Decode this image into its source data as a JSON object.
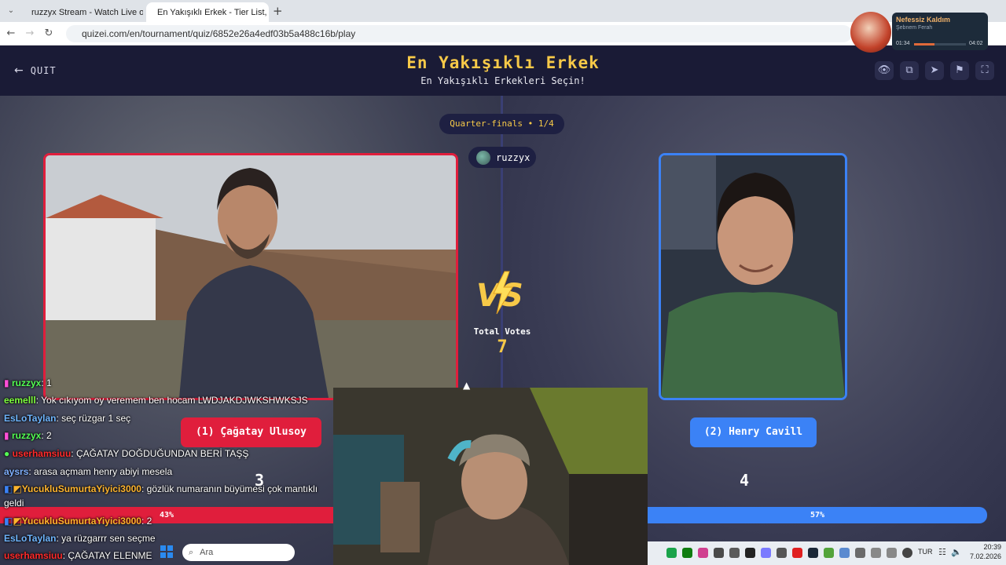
{
  "browser": {
    "tabs": [
      {
        "label": "ruzzyx Stream - Watch Live on K"
      },
      {
        "label": "En Yakışıklı Erkek - Tier List, Blin"
      }
    ],
    "new_tab": "+",
    "url": "quizei.com/en/tournament/quiz/6852e26a4edf03b5a488c16b/play"
  },
  "page": {
    "quit_label": "QUIT",
    "title": "En Yakışıklı Erkek",
    "subtitle": "En Yakışıklı Erkekleri Seçin!",
    "header_icons": [
      "eye-icon",
      "copy-icon",
      "send-icon",
      "flag-icon",
      "fullscreen-icon"
    ],
    "round_label": "Quarter-finals • 1/4",
    "username": "ruzzyx",
    "total_votes_label": "Total Votes",
    "total_votes": "7",
    "left": {
      "name": "(1) Çağatay Ulusoy",
      "votes": "3",
      "percent_label": "43%",
      "percent": 43,
      "color": "#e01e3c"
    },
    "right": {
      "name": "(2) Henry Cavill",
      "votes": "4",
      "percent_label": "57%",
      "percent": 57,
      "color": "#3b82f6"
    },
    "accent": "#f7c948"
  },
  "chat": [
    {
      "user": "ruzzyx",
      "user_color": "#54ff54",
      "text": ": 1"
    },
    {
      "user": "eemelll",
      "user_color": "#7fff3f",
      "text": ": Yok cıkıyom oy veremem ben hocam LWDJAKDJWKSHWKSJS"
    },
    {
      "user": "EsLoTaylan",
      "user_color": "#6fb6ff",
      "text": ": seç rüzgar 1 seç"
    },
    {
      "user": "ruzzyx",
      "user_color": "#54ff54",
      "text": ": 2"
    },
    {
      "user": "userhamsiuu",
      "user_color": "#ff2a2a",
      "text": ": ÇAĞATAY DOĞDUĞUNDAN BERİ TAŞŞ"
    },
    {
      "user": "aysrs",
      "user_color": "#7fb0ff",
      "text": ": arasa açmam henry abiyi mesela"
    },
    {
      "user": "YucukluSumurtaYiyici3000",
      "user_color": "#ffb52e",
      "text": ": gözlük numaranın büyümesi çok mantıklı"
    },
    {
      "user": "",
      "user_color": "#ffffff",
      "text": "geldi"
    },
    {
      "user": "YucukluSumurtaYiyici3000",
      "user_color": "#ffb52e",
      "text": ": 2"
    },
    {
      "user": "EsLoTaylan",
      "user_color": "#6fb6ff",
      "text": ": ya rüzgarrr sen seçme"
    },
    {
      "user": "userhamsiuu",
      "user_color": "#ff2a2a",
      "text": ": ÇAĞATAY ELENME"
    }
  ],
  "now_playing": {
    "song": "Nefessiz Kaldım",
    "artist": "Şebnem Ferah",
    "elapsed": "01:34",
    "total": "04:02",
    "progress": 0.39
  },
  "taskbar": {
    "search_placeholder": "Ara",
    "lang": "TUR",
    "time": "20:39",
    "date": "7.02.2026"
  }
}
